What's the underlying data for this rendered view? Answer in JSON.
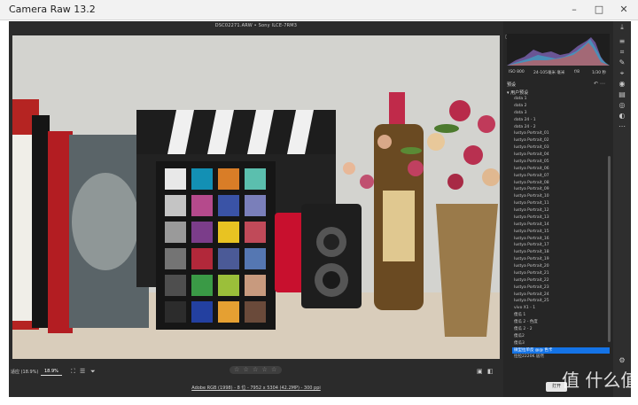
{
  "window": {
    "title": "Camera Raw 13.2"
  },
  "topbar": {
    "file_info": "DSC02271.ARW • Sony ILCE-7RM3"
  },
  "histogram_info": {
    "left": "ISO 800",
    "mid": "24-105毫米 毫米",
    "aperture": "f/8",
    "shutter": "1/30 秒"
  },
  "panel": {
    "title": "预设",
    "group": "用户预设",
    "presets": [
      "data 1",
      "data 2",
      "data 3",
      "data 24 - 1",
      "data 24 - 2",
      "Iustya Portrait_01",
      "Iustya Portrait_02",
      "Iustya Portrait_03",
      "Iustya Portrait_04",
      "Iustya Portrait_05",
      "Iustya Portrait_06",
      "Iustya Portrait_07",
      "Iustya Portrait_08",
      "Iustya Portrait_09",
      "Iustya Portrait_10",
      "Iustya Portrait_11",
      "Iustya Portrait_12",
      "Iustya Portrait_13",
      "Iustya Portrait_14",
      "Iustya Portrait_15",
      "Iustya Portrait_16",
      "Iustya Portrait_17",
      "Iustya Portrait_18",
      "Iustya Portrait_19",
      "Iustya Portrait_20",
      "Iustya Portrait_21",
      "Iustya Portrait_22",
      "Iustya Portrait_23",
      "Iustya Portrait_24",
      "Iustya Portrait_25",
      "vivo X1 - 1",
      "傻瓜 1",
      "傻瓜 2 - 色度",
      "傻瓜 2 - 2",
      "傻瓜2",
      "傻瓜3",
      "微型拉单反 @@ 色卡",
      "拉拉2220K 居然"
    ],
    "selected_index": 36
  },
  "bottombar": {
    "zoom_label": "适应 (18.9%)",
    "zoom_value": "18.9%",
    "stars": "☆ ☆ ☆ ☆ ☆",
    "colorspace": "Adobe RGB (1998) - 8 位 - 7952 x 5304 (42.2MP) - 300 ppi"
  },
  "buttons": {
    "open": "打开"
  },
  "watermark": {
    "text": "值 什么值得买"
  },
  "colors": {
    "accent": "#1473e6",
    "panel": "#262626",
    "app_bg": "#2b2b2b"
  },
  "icons": {
    "toolstrip": [
      "edit-icon",
      "crop-icon",
      "heal-icon",
      "mask-icon",
      "redeye-icon",
      "snapshot-icon",
      "presets-icon",
      "more-icon"
    ]
  }
}
